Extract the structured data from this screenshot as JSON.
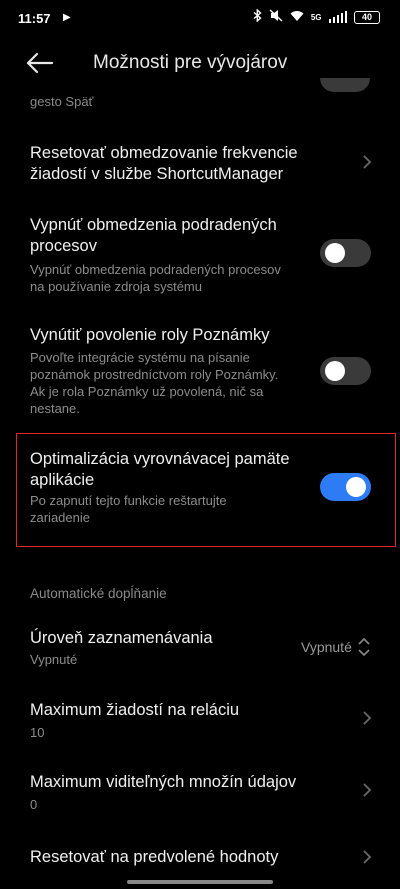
{
  "status_bar": {
    "time": "11:57",
    "play_icon": "▶",
    "battery": "40",
    "network": "5G"
  },
  "header": {
    "title": "Možnosti pre vývojárov"
  },
  "partial_item": {
    "subtitle": "gesto Späť"
  },
  "items": [
    {
      "title_lines": [
        "Resetovať obmedzovanie frekvencie",
        "žiadostí v službe ShortcutManager"
      ]
    },
    {
      "title_lines": [
        "Vypnúť obmedzenia podradených",
        "procesov"
      ],
      "subtitle_lines": [
        "Vypnúť obmedzenia podradených procesov",
        "na používanie zdroja systému"
      ],
      "toggle": "off"
    },
    {
      "title_lines": [
        "Vynútiť povolenie roly Poznámky"
      ],
      "subtitle_lines": [
        "Povoľte integrácie systému na písanie",
        "poznámok prostredníctvom roly Poznámky.",
        "Ak je rola Poznámky už povolená, nič sa",
        "nestane."
      ],
      "toggle": "off"
    },
    {
      "title_lines": [
        "Optimalizácia vyrovnávacej pamäte",
        "aplikácie"
      ],
      "subtitle_lines": [
        "Po zapnutí tejto funkcie reštartujte",
        "zariadenie"
      ],
      "toggle": "on"
    }
  ],
  "section": {
    "header": "Automatické dopĺňanie",
    "items": [
      {
        "title": "Úroveň zaznamenávania",
        "subtitle": "Vypnuté",
        "value": "Vypnuté"
      },
      {
        "title": "Maximum žiadostí na reláciu",
        "subtitle": "10"
      },
      {
        "title": "Maximum viditeľných množín údajov",
        "subtitle": "0"
      },
      {
        "title": "Resetovať na predvolené hodnoty"
      }
    ]
  },
  "colors": {
    "accent": "#2d7cf6",
    "highlight": "#e0262b",
    "background": "#000000"
  }
}
